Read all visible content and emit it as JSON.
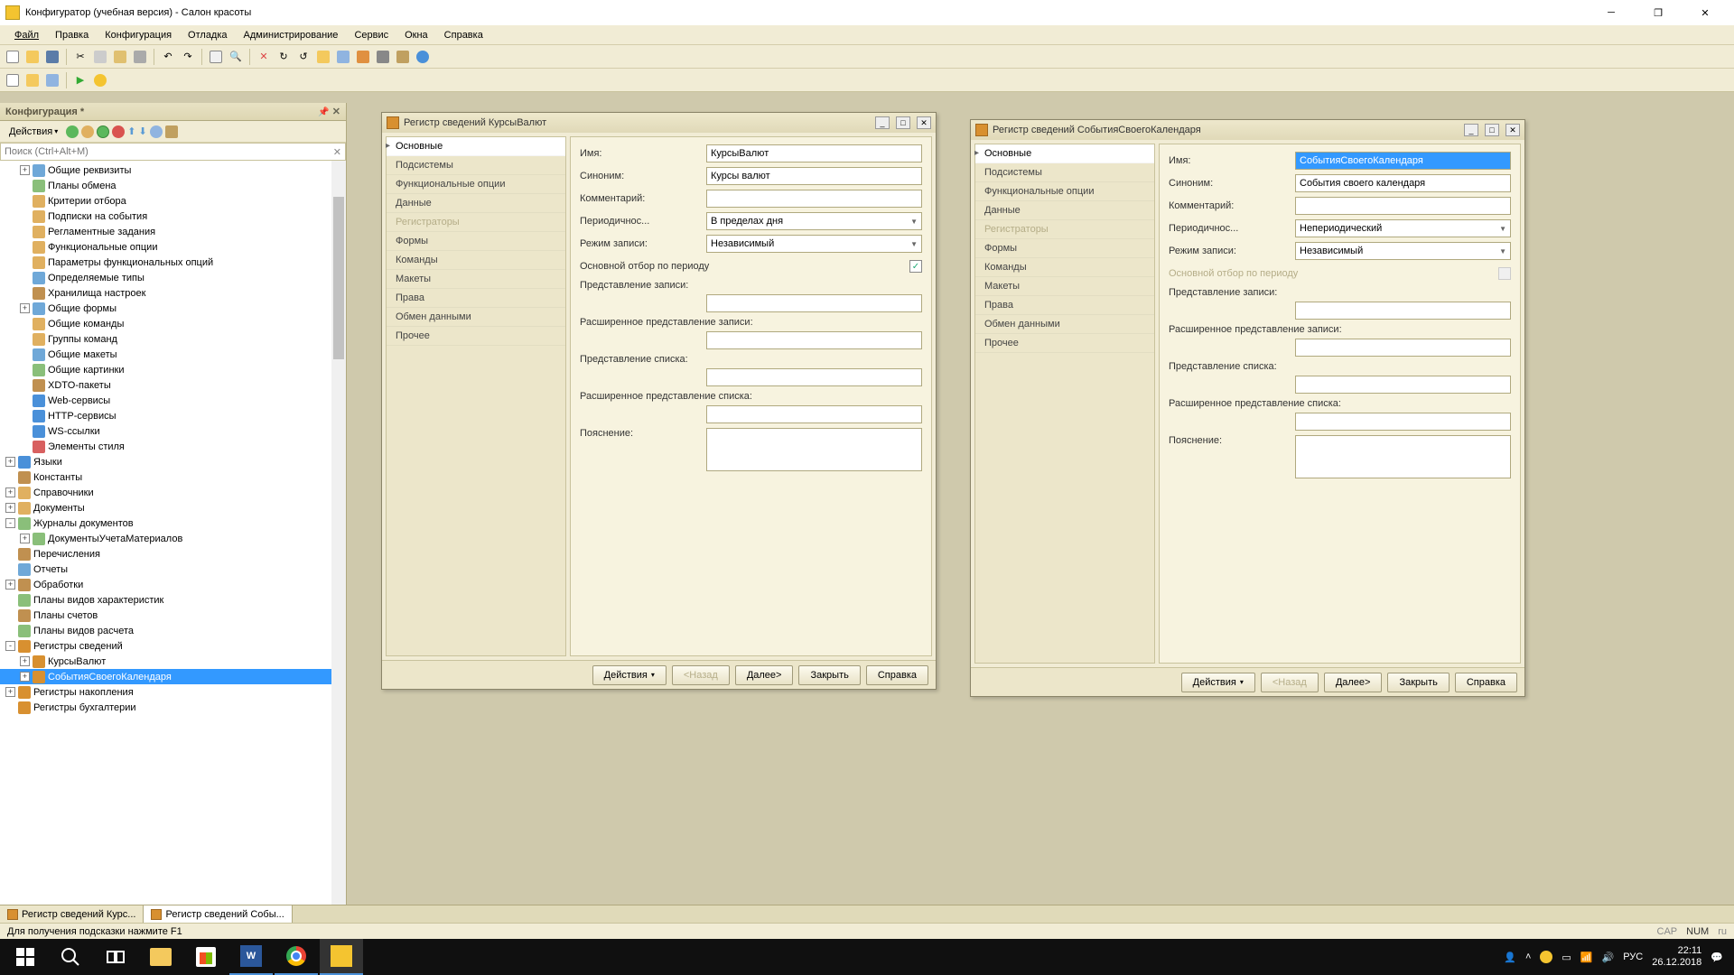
{
  "titlebar": {
    "title": "Конфигуратор (учебная версия) - Салон красоты"
  },
  "menu": {
    "items": [
      "Файл",
      "Правка",
      "Конфигурация",
      "Отладка",
      "Администрирование",
      "Сервис",
      "Окна",
      "Справка"
    ]
  },
  "config_panel": {
    "title": "Конфигурация *",
    "actions_label": "Действия",
    "search_placeholder": "Поиск (Ctrl+Alt+M)"
  },
  "tree": [
    {
      "indent": 1,
      "exp": "+",
      "icon": "#6fa8d8",
      "label": "Общие реквизиты"
    },
    {
      "indent": 1,
      "exp": "",
      "icon": "#8abf7a",
      "label": "Планы обмена"
    },
    {
      "indent": 1,
      "exp": "",
      "icon": "#e0b060",
      "label": "Критерии отбора"
    },
    {
      "indent": 1,
      "exp": "",
      "icon": "#e0b060",
      "label": "Подписки на события"
    },
    {
      "indent": 1,
      "exp": "",
      "icon": "#e0b060",
      "label": "Регламентные задания"
    },
    {
      "indent": 1,
      "exp": "",
      "icon": "#e0b060",
      "label": "Функциональные опции"
    },
    {
      "indent": 1,
      "exp": "",
      "icon": "#e0b060",
      "label": "Параметры функциональных опций"
    },
    {
      "indent": 1,
      "exp": "",
      "icon": "#6fa8d8",
      "label": "Определяемые типы"
    },
    {
      "indent": 1,
      "exp": "",
      "icon": "#c09050",
      "label": "Хранилища настроек"
    },
    {
      "indent": 1,
      "exp": "+",
      "icon": "#6fa8d8",
      "label": "Общие формы"
    },
    {
      "indent": 1,
      "exp": "",
      "icon": "#e0b060",
      "label": "Общие команды"
    },
    {
      "indent": 1,
      "exp": "",
      "icon": "#e0b060",
      "label": "Группы команд"
    },
    {
      "indent": 1,
      "exp": "",
      "icon": "#6fa8d8",
      "label": "Общие макеты"
    },
    {
      "indent": 1,
      "exp": "",
      "icon": "#8abf7a",
      "label": "Общие картинки"
    },
    {
      "indent": 1,
      "exp": "",
      "icon": "#c09050",
      "label": "XDTO-пакеты"
    },
    {
      "indent": 1,
      "exp": "",
      "icon": "#4a90d9",
      "label": "Web-сервисы"
    },
    {
      "indent": 1,
      "exp": "",
      "icon": "#4a90d9",
      "label": "HTTP-сервисы"
    },
    {
      "indent": 1,
      "exp": "",
      "icon": "#4a90d9",
      "label": "WS-ссылки"
    },
    {
      "indent": 1,
      "exp": "",
      "icon": "#d86060",
      "label": "Элементы стиля"
    },
    {
      "indent": 0,
      "exp": "+",
      "icon": "#4a90d9",
      "label": "Языки"
    },
    {
      "indent": 0,
      "exp": "",
      "icon": "#c09050",
      "label": "Константы"
    },
    {
      "indent": 0,
      "exp": "+",
      "icon": "#e0b060",
      "label": "Справочники"
    },
    {
      "indent": 0,
      "exp": "+",
      "icon": "#e0b060",
      "label": "Документы"
    },
    {
      "indent": 0,
      "exp": "-",
      "icon": "#8abf7a",
      "label": "Журналы документов"
    },
    {
      "indent": 1,
      "exp": "+",
      "icon": "#8abf7a",
      "label": "ДокументыУчетаМатериалов"
    },
    {
      "indent": 0,
      "exp": "",
      "icon": "#c09050",
      "label": "Перечисления"
    },
    {
      "indent": 0,
      "exp": "",
      "icon": "#6fa8d8",
      "label": "Отчеты"
    },
    {
      "indent": 0,
      "exp": "+",
      "icon": "#c09050",
      "label": "Обработки"
    },
    {
      "indent": 0,
      "exp": "",
      "icon": "#8abf7a",
      "label": "Планы видов характеристик"
    },
    {
      "indent": 0,
      "exp": "",
      "icon": "#c09050",
      "label": "Планы счетов"
    },
    {
      "indent": 0,
      "exp": "",
      "icon": "#8abf7a",
      "label": "Планы видов расчета"
    },
    {
      "indent": 0,
      "exp": "-",
      "icon": "#d89030",
      "label": "Регистры сведений"
    },
    {
      "indent": 1,
      "exp": "+",
      "icon": "#d89030",
      "label": "КурсыВалют"
    },
    {
      "indent": 1,
      "exp": "+",
      "icon": "#d89030",
      "label": "СобытияСвоегоКалендаря",
      "selected": true
    },
    {
      "indent": 0,
      "exp": "+",
      "icon": "#d89030",
      "label": "Регистры накопления"
    },
    {
      "indent": 0,
      "exp": "",
      "icon": "#d89030",
      "label": "Регистры бухгалтерии"
    }
  ],
  "nav_items": [
    "Основные",
    "Подсистемы",
    "Функциональные опции",
    "Данные",
    "Регистраторы",
    "Формы",
    "Команды",
    "Макеты",
    "Права",
    "Обмен данными",
    "Прочее"
  ],
  "form_labels": {
    "name": "Имя:",
    "synonym": "Синоним:",
    "comment": "Комментарий:",
    "periodicity": "Периодичнос...",
    "write_mode": "Режим записи:",
    "main_filter": "Основной отбор по периоду",
    "record_repr": "Представление записи:",
    "ext_record_repr": "Расширенное представление записи:",
    "list_repr": "Представление списка:",
    "ext_list_repr": "Расширенное представление списка:",
    "explanation": "Пояснение:"
  },
  "win1": {
    "title": "Регистр сведений КурсыВалют",
    "name": "КурсыВалют",
    "synonym": "Курсы валют",
    "periodicity": "В пределах дня",
    "write_mode": "Независимый",
    "main_filter_checked": true
  },
  "win2": {
    "title": "Регистр сведений СобытияСвоегоКалендаря",
    "name": "СобытияСвоегоКалендаря",
    "synonym": "События своего календаря",
    "periodicity": "Непериодический",
    "write_mode": "Независимый",
    "main_filter_checked": false
  },
  "footer_buttons": {
    "actions": "Действия",
    "back": "<Назад",
    "next": "Далее>",
    "close": "Закрыть",
    "help": "Справка"
  },
  "footer_tabs": {
    "tab1": "Регистр сведений Курс...",
    "tab2": "Регистр сведений Собы..."
  },
  "statusbar": {
    "hint": "Для получения подсказки нажмите F1",
    "cap": "CAP",
    "num": "NUM",
    "lang": "ru"
  },
  "taskbar": {
    "lang": "РУС",
    "time": "22:11",
    "date": "26.12.2018"
  }
}
